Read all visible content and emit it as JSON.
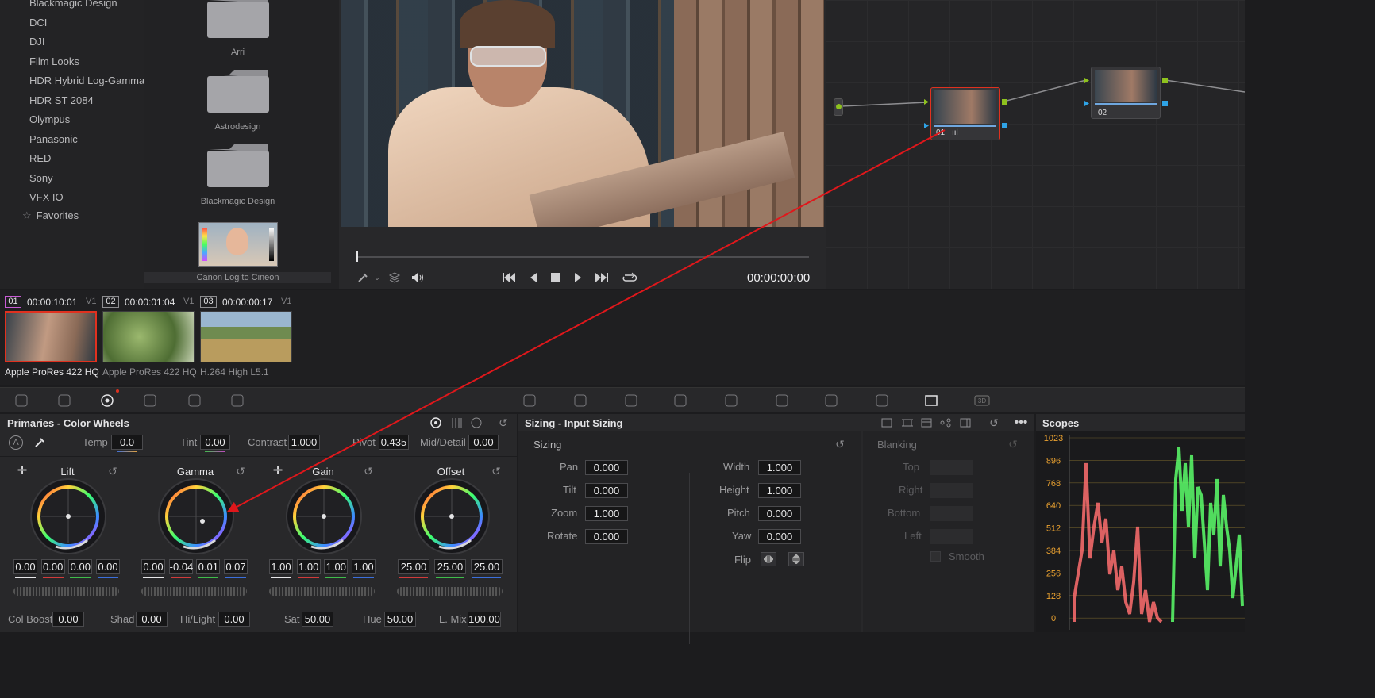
{
  "lut_browser": {
    "items": [
      "Blackmagic Design",
      "DCI",
      "DJI",
      "Film Looks",
      "HDR Hybrid Log-Gamma",
      "HDR ST 2084",
      "Olympus",
      "Panasonic",
      "RED",
      "Sony",
      "VFX IO"
    ],
    "favorites": "Favorites",
    "folders": [
      "Arri",
      "Astrodesign",
      "Blackmagic Design"
    ],
    "lut_thumb_label": "Canon Log to Cineon"
  },
  "viewer": {
    "timecode": "00:00:00:00"
  },
  "node_graph": {
    "nodes": [
      "01",
      "02"
    ]
  },
  "clips": [
    {
      "num": "01",
      "tc": "00:00:10:01",
      "track": "V1",
      "codec": "Apple ProRes 422 HQ"
    },
    {
      "num": "02",
      "tc": "00:00:01:04",
      "track": "V1",
      "codec": "Apple ProRes 422 HQ"
    },
    {
      "num": "03",
      "tc": "00:00:00:17",
      "track": "V1",
      "codec": "H.264 High L5.1"
    }
  ],
  "primaries": {
    "title": "Primaries - Color Wheels",
    "auto": "A",
    "temp_label": "Temp",
    "temp": "0.0",
    "tint_label": "Tint",
    "tint": "0.00",
    "contrast_label": "Contrast",
    "contrast": "1.000",
    "pivot_label": "Pivot",
    "pivot": "0.435",
    "middetail_label": "Mid/Detail",
    "middetail": "0.00",
    "wheels": [
      {
        "name": "Lift",
        "values": [
          "0.00",
          "0.00",
          "0.00",
          "0.00"
        ]
      },
      {
        "name": "Gamma",
        "values": [
          "0.00",
          "-0.04",
          "0.01",
          "0.07"
        ]
      },
      {
        "name": "Gain",
        "values": [
          "1.00",
          "1.00",
          "1.00",
          "1.00"
        ]
      },
      {
        "name": "Offset",
        "values": [
          "25.00",
          "25.00",
          "25.00"
        ]
      }
    ],
    "colboost_label": "Col Boost",
    "colboost": "0.00",
    "shad_label": "Shad",
    "shad": "0.00",
    "hilight_label": "Hi/Light",
    "hilight": "0.00",
    "sat_label": "Sat",
    "sat": "50.00",
    "hue_label": "Hue",
    "hue": "50.00",
    "lmix_label": "L. Mix",
    "lmix": "100.00"
  },
  "sizing": {
    "title": "Sizing - Input Sizing",
    "section": "Sizing",
    "pan_label": "Pan",
    "pan": "0.000",
    "tilt_label": "Tilt",
    "tilt": "0.000",
    "zoom_label": "Zoom",
    "zoom": "1.000",
    "rotate_label": "Rotate",
    "rotate": "0.000",
    "width_label": "Width",
    "width": "1.000",
    "height_label": "Height",
    "height": "1.000",
    "pitch_label": "Pitch",
    "pitch": "0.000",
    "yaw_label": "Yaw",
    "yaw": "0.000",
    "flip_label": "Flip",
    "blanking": "Blanking",
    "top": "Top",
    "right": "Right",
    "bottom": "Bottom",
    "left": "Left",
    "smooth": "Smooth"
  },
  "scopes": {
    "title": "Scopes",
    "ticks": [
      "1023",
      "896",
      "768",
      "640",
      "512",
      "384",
      "256",
      "128",
      "0"
    ]
  },
  "colors": {
    "accent_red": "#e0311f",
    "panel": "#28282a",
    "lift_red": "#d23b3b",
    "lift_green": "#3fbd4b",
    "lift_blue": "#3b6fdc"
  }
}
